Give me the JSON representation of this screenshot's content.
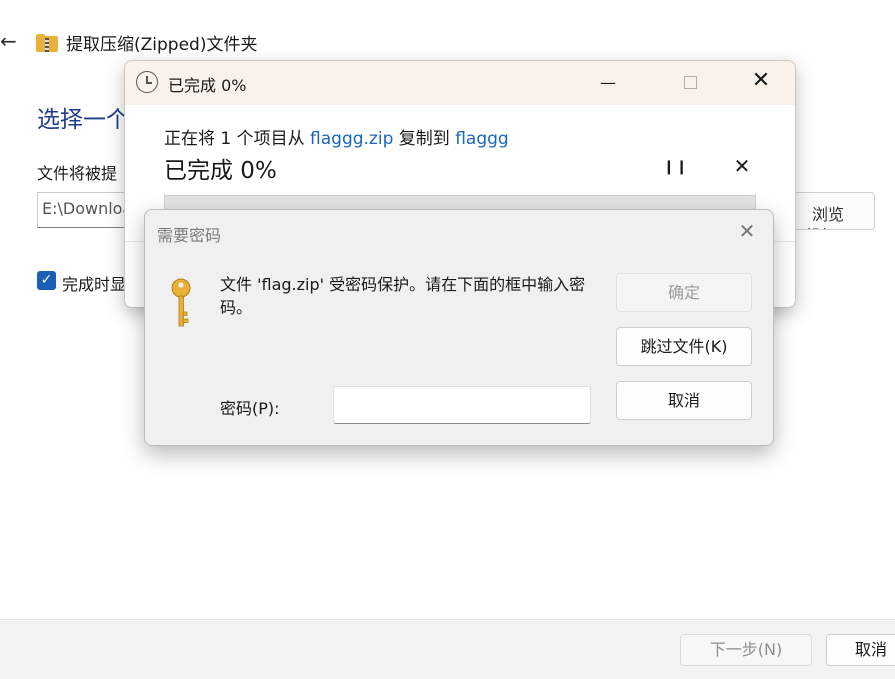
{
  "wizard": {
    "back_glyph": "←",
    "title": "提取压缩(Zipped)文件夹",
    "heading": "选择一个",
    "label": "文件将被提",
    "path_value": "E:\\Download",
    "browse_label": "浏览(R)...",
    "show_files_label": "完成时显",
    "next_label": "下一步(N)",
    "cancel_label": "取消"
  },
  "progress": {
    "title": "已完成 0%",
    "status_prefix": "正在将 1 个项目从 ",
    "source": "flaggg.zip",
    "status_mid": " 复制到 ",
    "dest": "flaggg",
    "percent_text": "已完成 0%",
    "percent": 0,
    "min_glyph": "—",
    "close_glyph": "✕",
    "pause_glyph": "❙❙",
    "stop_glyph": "✕"
  },
  "password_dialog": {
    "title": "需要密码",
    "close_glyph": "✕",
    "message": "文件 'flag.zip' 受密码保护。请在下面的框中输入密码。",
    "password_label": "密码(P):",
    "password_value": "",
    "ok_label": "确定",
    "skip_label": "跳过文件(K)",
    "cancel_label": "取消"
  },
  "colors": {
    "heading": "#1f3d8a",
    "link": "#1a66c0",
    "checkbox": "#1a5fb4",
    "progress_fill": "#06b025",
    "titlebar": "#f9f1ea",
    "key": "#e8b23a"
  }
}
